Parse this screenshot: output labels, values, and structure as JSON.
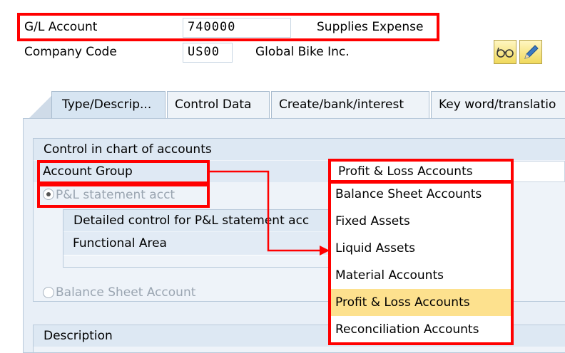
{
  "header": {
    "gl_label": "G/L Account",
    "gl_value": "740000",
    "gl_desc": "Supplies Expense",
    "cc_label": "Company Code",
    "cc_value": "US00",
    "cc_desc": "Global Bike Inc."
  },
  "toolbar": {
    "display_icon": "glasses-icon",
    "edit_icon": "pencil-icon"
  },
  "tabs": [
    {
      "label": "Type/Descrip..."
    },
    {
      "label": "Control Data"
    },
    {
      "label": "Create/bank/interest"
    },
    {
      "label": "Key word/translatio"
    }
  ],
  "control": {
    "section_title": "Control in chart of accounts",
    "account_group_label": "Account Group",
    "account_group_value": "Profit & Loss Accounts",
    "pl_radio_label": "P&L statement acct",
    "detailed_control_label": "Detailed control for P&L statement acc",
    "functional_area_label": "Functional Area",
    "bs_radio_label": "Balance Sheet Account"
  },
  "dropdown": {
    "options": [
      {
        "label": "Balance Sheet Accounts"
      },
      {
        "label": "Fixed Assets"
      },
      {
        "label": "Liquid Assets"
      },
      {
        "label": "Material Accounts"
      },
      {
        "label": "Profit & Loss Accounts"
      },
      {
        "label": "Reconciliation Accounts"
      }
    ],
    "selected": "Profit & Loss Accounts"
  },
  "description": {
    "section_title": "Description"
  },
  "colors": {
    "highlight": "#ff0000",
    "selected_option": "#fde18e",
    "panel_bg": "#eef3f9"
  }
}
